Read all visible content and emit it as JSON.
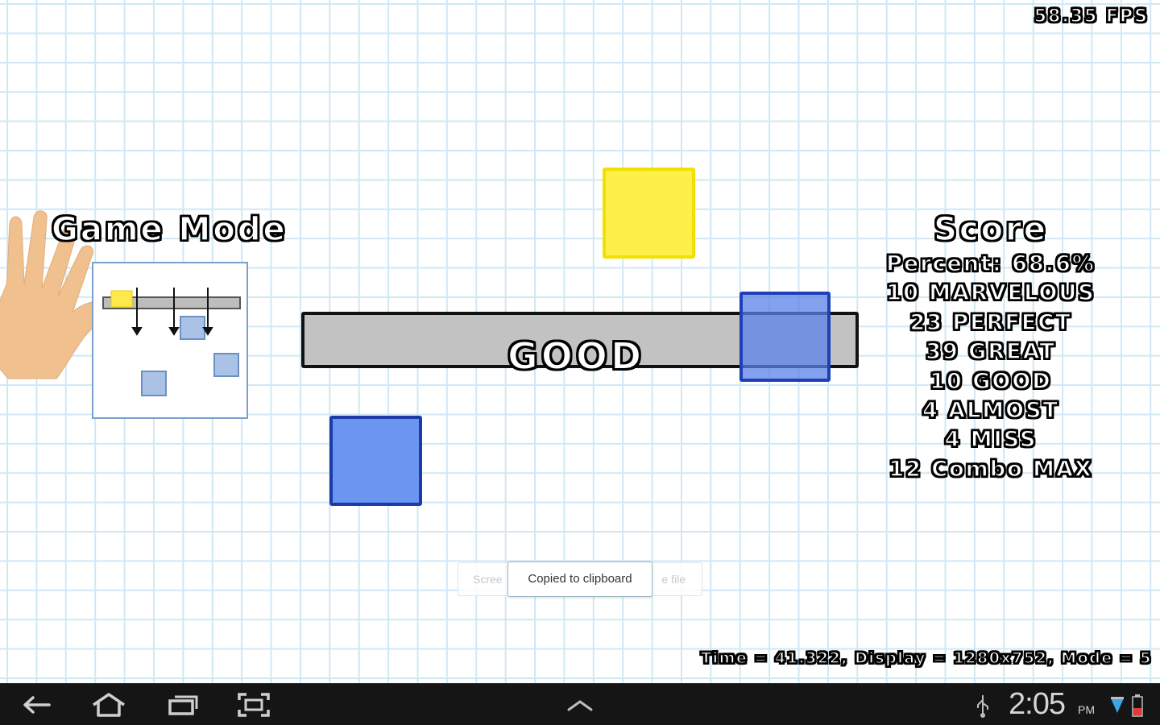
{
  "hud": {
    "fps": "58.35 FPS",
    "debug_info": "Time = 41.322, Display = 1280x752, Mode = 5"
  },
  "game_mode": {
    "title": "Game Mode"
  },
  "judgement": {
    "text": "GOOD"
  },
  "score": {
    "title": "Score",
    "lines": [
      "Percent: 68.6%",
      "10 MARVELOUS",
      "23 PERFECT",
      "39 GREAT",
      "10 GOOD",
      "4 ALMOST",
      "4 MISS",
      "12 Combo MAX"
    ]
  },
  "toast": {
    "message": "Copied to clipboard",
    "behind_left": "Scree",
    "behind_right": "e file"
  },
  "statusbar": {
    "time": "2:05",
    "ampm": "PM"
  },
  "colors": {
    "grid_line": "#cfe8f5",
    "note_yellow": "#ffef4a",
    "note_blue": "#6a95f0",
    "judge_bar": "#c2c2c2",
    "navbar": "#151515"
  }
}
